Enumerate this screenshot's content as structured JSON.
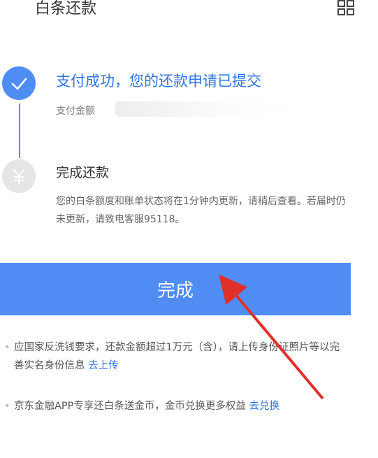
{
  "header": {
    "title": "白条还款",
    "menu_icon": "grid-icon"
  },
  "steps": [
    {
      "title": "支付成功，您的还款申请已提交",
      "subtitle": "支付金额",
      "icon": "check-icon",
      "status": "done"
    },
    {
      "title": "完成还款",
      "icon": "yen-icon",
      "status": "pending",
      "description": "您的白条额度和账单状态将在1分钟内更新，请稍后查看。若届时仍未更新，请致电客服95118。"
    }
  ],
  "done_button": {
    "label": "完成"
  },
  "notes": [
    {
      "text": "应国家反洗钱要求，还款金额超过1万元（含），请上传身份证照片等以完善实名身份信息",
      "link": "去上传"
    },
    {
      "text": "京东金融APP专享还白条送金币，金币兑换更多权益",
      "link": "去兑换"
    }
  ],
  "colors": {
    "accent": "#4f8df5",
    "link": "#2f74e6",
    "annotation": "#e0302a"
  }
}
